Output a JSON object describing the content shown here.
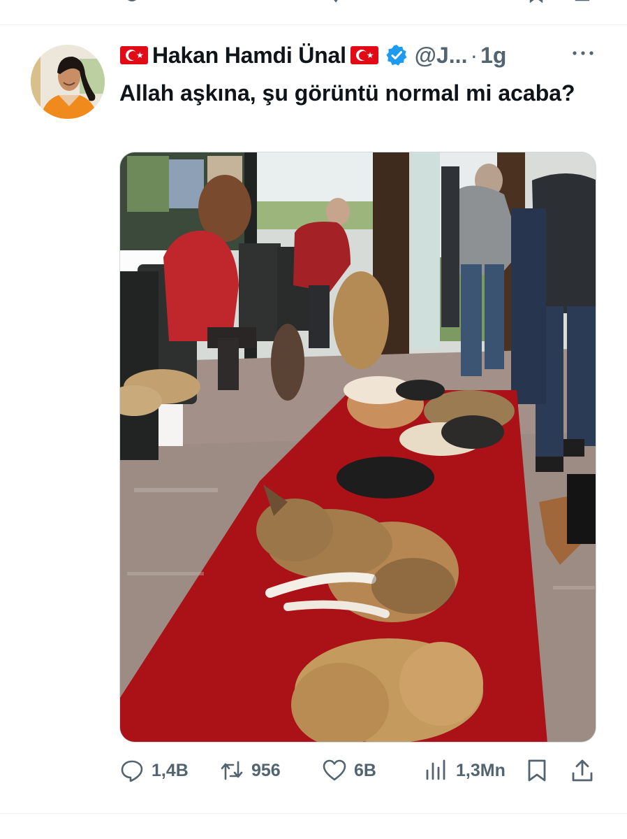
{
  "tweet": {
    "display_name": "Hakan Hamdi Ünal",
    "handle": "@J...",
    "separator": "·",
    "time": "1g",
    "text": "Allah aşkına, şu görüntü normal mi acaba?",
    "verified": true,
    "flag_icon": "turkey-flag-icon",
    "accent_color": "#1d9bf0",
    "text_color": "#0f1419",
    "muted_color": "#536471"
  },
  "media": {
    "type": "photo",
    "scene_colors": {
      "carpet": "#b31318",
      "floor": "#a08f86",
      "dog_tan": "#b48a55"
    }
  },
  "actions": {
    "reply": {
      "icon": "reply-icon",
      "count": "1,4B"
    },
    "retweet": {
      "icon": "retweet-icon",
      "count": "956"
    },
    "like": {
      "icon": "heart-icon",
      "count": "6B"
    },
    "views": {
      "icon": "views-icon",
      "count": "1,3Mn"
    },
    "bookmark": {
      "icon": "bookmark-icon"
    },
    "share": {
      "icon": "share-icon"
    }
  }
}
